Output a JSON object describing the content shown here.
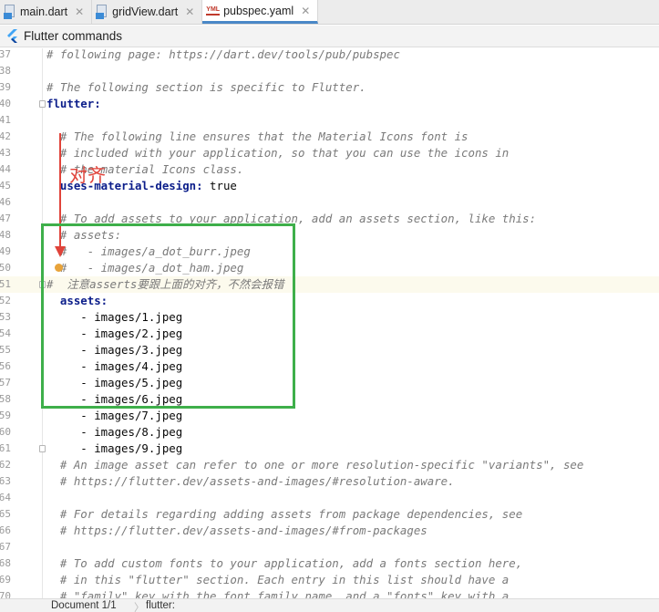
{
  "tabs": [
    {
      "label": "main.dart",
      "icon": "dart-file-icon",
      "active": false
    },
    {
      "label": "gridView.dart",
      "icon": "dart-file-icon",
      "active": false
    },
    {
      "label": "pubspec.yaml",
      "icon": "yaml-file-icon",
      "active": true
    }
  ],
  "yaml_icon_text": "YML",
  "close_glyph": "✕",
  "commands_bar": {
    "label": "Flutter commands"
  },
  "annotation": {
    "label": "对齐",
    "arrow_color": "#e0433a",
    "box_color": "#3eaf4a"
  },
  "status": {
    "document": "Document 1/1",
    "breadcrumb": "flutter:"
  },
  "colors": {
    "comment": "#7a7a7a",
    "keyword": "#0b1d8a",
    "current_line": "#fcfaed"
  },
  "code_lines": [
    {
      "num": "37",
      "parts": [
        {
          "t": "# following page: ",
          "s": "c"
        },
        {
          "t": "https://dart.dev/tools/pub/pubspec",
          "s": "cl"
        }
      ]
    },
    {
      "num": "38",
      "parts": []
    },
    {
      "num": "39",
      "parts": [
        {
          "t": "# The following section is specific to Flutter.",
          "s": "c"
        }
      ]
    },
    {
      "num": "40",
      "parts": [
        {
          "t": "flutter:",
          "s": "k"
        }
      ]
    },
    {
      "num": "41",
      "parts": []
    },
    {
      "num": "42",
      "parts": [
        {
          "t": "  # The following line ensures that the Material Icons font is",
          "s": "c"
        }
      ]
    },
    {
      "num": "43",
      "parts": [
        {
          "t": "  # included with your application, so that you can use the icons in",
          "s": "c"
        }
      ]
    },
    {
      "num": "44",
      "parts": [
        {
          "t": "  # the material Icons class.",
          "s": "c"
        }
      ]
    },
    {
      "num": "45",
      "parts": [
        {
          "t": "  uses-material-design:",
          "s": "k"
        },
        {
          "t": " true",
          "s": "v"
        }
      ]
    },
    {
      "num": "46",
      "parts": []
    },
    {
      "num": "47",
      "parts": [
        {
          "t": "  # To add assets to your application, add an assets section, like this:",
          "s": "c"
        }
      ]
    },
    {
      "num": "48",
      "parts": [
        {
          "t": "  # assets:",
          "s": "c"
        }
      ]
    },
    {
      "num": "49",
      "parts": [
        {
          "t": "  #   - images/a_dot_burr.jpeg",
          "s": "c"
        }
      ]
    },
    {
      "num": "50",
      "parts": [
        {
          "t": "  #   - images/a_dot_ham.jpeg",
          "s": "c"
        }
      ]
    },
    {
      "num": "51",
      "parts": [
        {
          "t": "#  注意asserts要跟上面的对齐，不然会报错",
          "s": "c"
        }
      ]
    },
    {
      "num": "52",
      "parts": [
        {
          "t": "  assets:",
          "s": "k"
        }
      ]
    },
    {
      "num": "53",
      "parts": [
        {
          "t": "     - images/1.jpeg",
          "s": "v"
        }
      ]
    },
    {
      "num": "54",
      "parts": [
        {
          "t": "     - images/2.jpeg",
          "s": "v"
        }
      ]
    },
    {
      "num": "55",
      "parts": [
        {
          "t": "     - images/3.jpeg",
          "s": "v"
        }
      ]
    },
    {
      "num": "56",
      "parts": [
        {
          "t": "     - images/4.jpeg",
          "s": "v"
        }
      ]
    },
    {
      "num": "57",
      "parts": [
        {
          "t": "     - images/5.jpeg",
          "s": "v"
        }
      ]
    },
    {
      "num": "58",
      "parts": [
        {
          "t": "     - images/6.jpeg",
          "s": "v"
        }
      ]
    },
    {
      "num": "59",
      "parts": [
        {
          "t": "     - images/7.jpeg",
          "s": "v"
        }
      ]
    },
    {
      "num": "60",
      "parts": [
        {
          "t": "     - images/8.jpeg",
          "s": "v"
        }
      ]
    },
    {
      "num": "61",
      "parts": [
        {
          "t": "     - images/9.jpeg",
          "s": "v"
        }
      ]
    },
    {
      "num": "62",
      "parts": [
        {
          "t": "  # An image asset can refer to one or more resolution-specific \"variants\", see",
          "s": "c"
        }
      ]
    },
    {
      "num": "63",
      "parts": [
        {
          "t": "  # ",
          "s": "c"
        },
        {
          "t": "https://flutter.dev/assets-and-images/#resolution-aware",
          "s": "cl"
        },
        {
          "t": ".",
          "s": "c"
        }
      ]
    },
    {
      "num": "64",
      "parts": []
    },
    {
      "num": "65",
      "parts": [
        {
          "t": "  # For details regarding adding assets from package dependencies, see",
          "s": "c"
        }
      ]
    },
    {
      "num": "66",
      "parts": [
        {
          "t": "  # ",
          "s": "c"
        },
        {
          "t": "https://flutter.dev/assets-and-images/#from-packages",
          "s": "cl"
        }
      ]
    },
    {
      "num": "67",
      "parts": []
    },
    {
      "num": "68",
      "parts": [
        {
          "t": "  # To add custom fonts to your application, add a fonts section here,",
          "s": "c"
        }
      ]
    },
    {
      "num": "69",
      "parts": [
        {
          "t": "  # in this \"flutter\" section. Each entry in this list should have a",
          "s": "c"
        }
      ]
    },
    {
      "num": "70",
      "parts": [
        {
          "t": "  # \"family\" key with the font family name, and a \"fonts\" key with a",
          "s": "c"
        }
      ]
    }
  ]
}
